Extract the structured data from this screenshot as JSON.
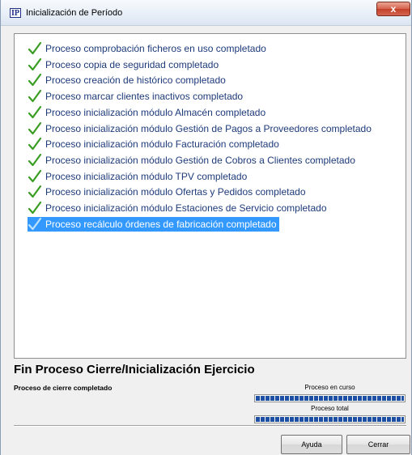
{
  "window": {
    "title": "Inicialización de Período",
    "app_icon_text": "IP",
    "close_glyph": "x"
  },
  "log": {
    "items": [
      {
        "label": "Proceso comprobación ficheros en uso completado",
        "icon": "check-icon",
        "selected": false
      },
      {
        "label": "Proceso copia de seguridad completado",
        "icon": "check-icon",
        "selected": false
      },
      {
        "label": "Proceso creación de histórico completado",
        "icon": "check-icon",
        "selected": false
      },
      {
        "label": "Proceso marcar clientes inactivos completado",
        "icon": "check-icon",
        "selected": false
      },
      {
        "label": "Proceso inicialización módulo Almacén completado",
        "icon": "check-icon",
        "selected": false
      },
      {
        "label": "Proceso inicialización módulo Gestión de Pagos a Proveedores completado",
        "icon": "check-icon",
        "selected": false
      },
      {
        "label": "Proceso inicialización módulo Facturación completado",
        "icon": "check-icon",
        "selected": false
      },
      {
        "label": "Proceso inicialización módulo Gestión de Cobros a Clientes completado",
        "icon": "check-icon",
        "selected": false
      },
      {
        "label": "Proceso inicialización módulo TPV completado",
        "icon": "check-icon",
        "selected": false
      },
      {
        "label": "Proceso inicialización módulo Ofertas y Pedidos completado",
        "icon": "check-icon",
        "selected": false
      },
      {
        "label": "Proceso inicialización módulo Estaciones de Servicio completado",
        "icon": "check-icon",
        "selected": false
      },
      {
        "label": "Proceso recálculo órdenes de fabricación completado",
        "icon": "check-icon",
        "selected": true
      }
    ]
  },
  "summary": {
    "title": "Fin Proceso Cierre/Inicialización Ejercicio",
    "status": "Proceso de cierre completado"
  },
  "progress": {
    "current_label": "Proceso en curso",
    "current_value": 1.0,
    "total_label": "Proceso total",
    "total_value": 1.0
  },
  "buttons": {
    "help_label": "Ayuda",
    "close_label": "Cerrar"
  },
  "colors": {
    "check_green": "#3a9d23",
    "item_text": "#1d3a7a",
    "selection": "#3399ff",
    "progress_fill": "#1d4fa5"
  }
}
